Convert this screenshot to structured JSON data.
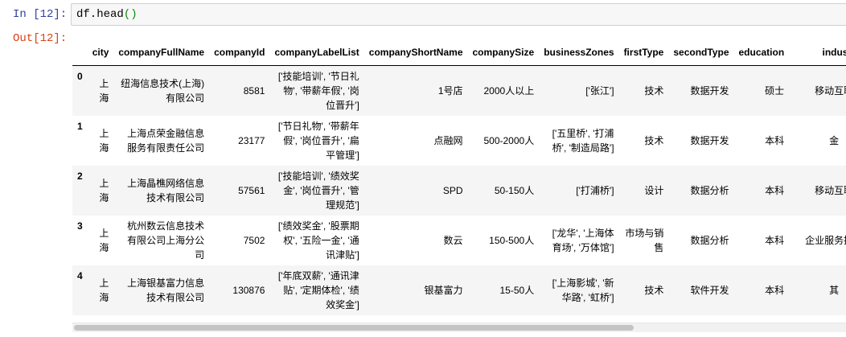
{
  "input_cell": {
    "prompt": "In [12]:",
    "code_main": "df.head",
    "code_paren": "()"
  },
  "output_cell": {
    "prompt": "Out[12]:"
  },
  "table": {
    "columns": [
      "city",
      "companyFullName",
      "companyId",
      "companyLabelList",
      "companyShortName",
      "companySize",
      "businessZones",
      "firstType",
      "secondType",
      "education",
      "industryFie"
    ],
    "rows": [
      {
        "index": "0",
        "city": "上海",
        "companyFullName": "纽海信息技术(上海)有限公司",
        "companyId": "8581",
        "companyLabelList": "['技能培训', '节日礼物', '带薪年假', '岗位晋升']",
        "companyShortName": "1号店",
        "companySize": "2000人以上",
        "businessZones": "['张江']",
        "firstType": "技术",
        "secondType": "数据开发",
        "education": "硕士",
        "industryField": "移动互联"
      },
      {
        "index": "1",
        "city": "上海",
        "companyFullName": "上海点荣金融信息服务有限责任公司",
        "companyId": "23177",
        "companyLabelList": "['节日礼物', '带薪年假', '岗位晋升', '扁平管理']",
        "companyShortName": "点融网",
        "companySize": "500-2000人",
        "businessZones": "['五里桥', '打浦桥', '制造局路']",
        "firstType": "技术",
        "secondType": "数据开发",
        "education": "本科",
        "industryField": "金"
      },
      {
        "index": "2",
        "city": "上海",
        "companyFullName": "上海晶樵网络信息技术有限公司",
        "companyId": "57561",
        "companyLabelList": "['技能培训', '绩效奖金', '岗位晋升', '管理规范']",
        "companyShortName": "SPD",
        "companySize": "50-150人",
        "businessZones": "['打浦桥']",
        "firstType": "设计",
        "secondType": "数据分析",
        "education": "本科",
        "industryField": "移动互联"
      },
      {
        "index": "3",
        "city": "上海",
        "companyFullName": "杭州数云信息技术有限公司上海分公司",
        "companyId": "7502",
        "companyLabelList": "['绩效奖金', '股票期权', '五险一金', '通讯津贴']",
        "companyShortName": "数云",
        "companySize": "150-500人",
        "businessZones": "['龙华', '上海体育场', '万体馆']",
        "firstType": "市场与销售",
        "secondType": "数据分析",
        "education": "本科",
        "industryField": "企业服务据服"
      },
      {
        "index": "4",
        "city": "上海",
        "companyFullName": "上海银基富力信息技术有限公司",
        "companyId": "130876",
        "companyLabelList": "['年底双薪', '通讯津贴', '定期体检', '绩效奖金']",
        "companyShortName": "银基富力",
        "companySize": "15-50人",
        "businessZones": "['上海影城', '新华路', '虹桥']",
        "firstType": "技术",
        "secondType": "软件开发",
        "education": "本科",
        "industryField": "其"
      }
    ]
  }
}
